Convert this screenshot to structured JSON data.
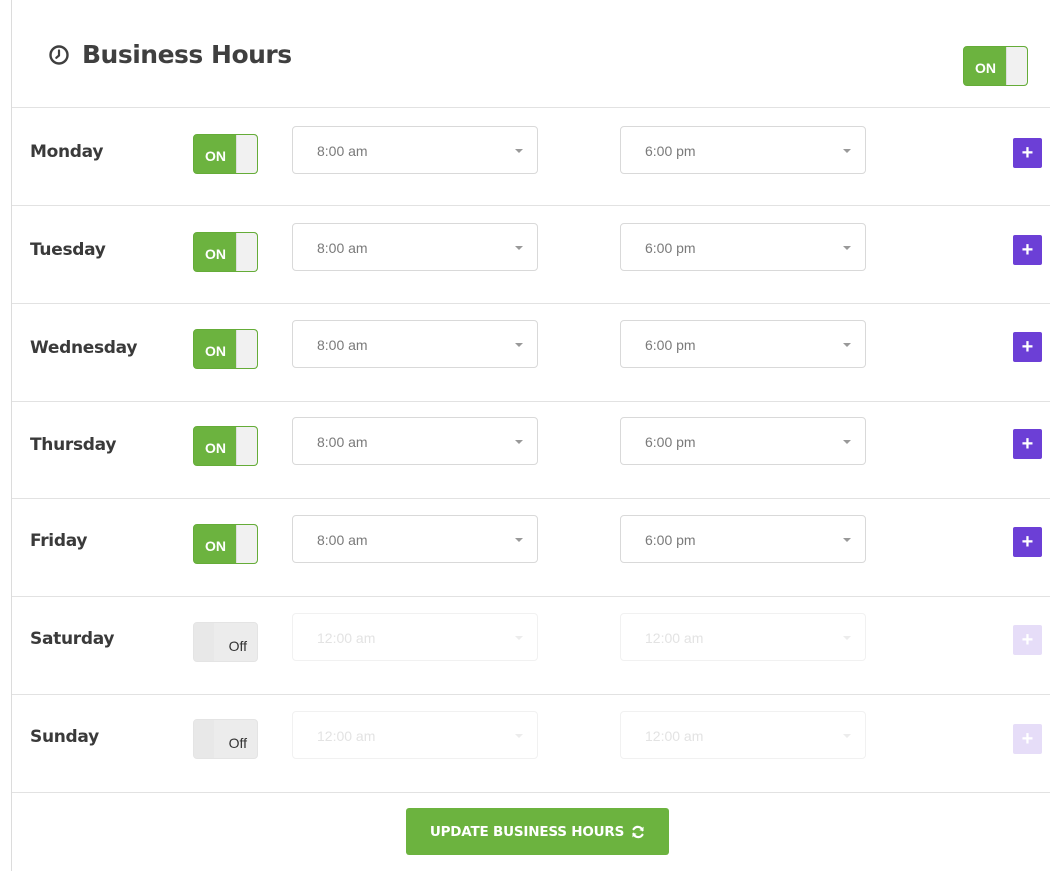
{
  "header": {
    "title": "Business Hours",
    "icon": "clock-icon",
    "master_toggle": "ON"
  },
  "days": [
    {
      "name": "Monday",
      "toggle": "ON",
      "enabled": true,
      "open": "8:00 am",
      "close": "6:00 pm"
    },
    {
      "name": "Tuesday",
      "toggle": "ON",
      "enabled": true,
      "open": "8:00 am",
      "close": "6:00 pm"
    },
    {
      "name": "Wednesday",
      "toggle": "ON",
      "enabled": true,
      "open": "8:00 am",
      "close": "6:00 pm"
    },
    {
      "name": "Thursday",
      "toggle": "ON",
      "enabled": true,
      "open": "8:00 am",
      "close": "6:00 pm"
    },
    {
      "name": "Friday",
      "toggle": "ON",
      "enabled": true,
      "open": "8:00 am",
      "close": "6:00 pm"
    },
    {
      "name": "Saturday",
      "toggle": "Off",
      "enabled": false,
      "open": "12:00 am",
      "close": "12:00 am"
    },
    {
      "name": "Sunday",
      "toggle": "Off",
      "enabled": false,
      "open": "12:00 am",
      "close": "12:00 am"
    }
  ],
  "update_button": {
    "label": "UPDATE BUSINESS HOURS",
    "icon": "refresh-icon"
  },
  "colors": {
    "toggle_on": "#6cb33f",
    "add_button": "#6c3fd6",
    "update_button": "#6cb33f"
  }
}
